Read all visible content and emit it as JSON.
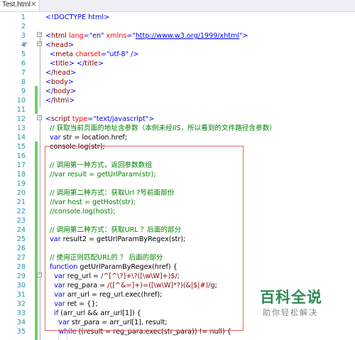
{
  "tab": {
    "label": "Test.html",
    "close": "✕"
  },
  "cursor_glyph": "⇙",
  "watermark": {
    "title": "百科全说",
    "subtitle": "助你轻松解决"
  },
  "lines": [
    {
      "n": "1",
      "seg": [
        [
          "<!DOCTYPE html>",
          "#0000ff"
        ]
      ]
    },
    {
      "n": "2",
      "seg": []
    },
    {
      "n": "3",
      "seg": [
        [
          "<",
          "#0000ff"
        ],
        [
          "html",
          "#800000"
        ],
        [
          " lang",
          "#ff0000"
        ],
        [
          "=",
          "#0000ff"
        ],
        [
          "\"en\"",
          "#0000ff"
        ],
        [
          " xmlns",
          "#ff0000"
        ],
        [
          "=",
          "#0000ff"
        ],
        [
          "\"",
          "#0000ff"
        ],
        [
          "http://www.w3.org/1999/xhtml",
          "#0000ff"
        ],
        [
          "\">",
          "#0000ff"
        ]
      ]
    },
    {
      "n": "4",
      "seg": [
        [
          "<",
          "#0000ff"
        ],
        [
          "head",
          "#800000"
        ],
        [
          ">",
          "#0000ff"
        ]
      ]
    },
    {
      "n": "5",
      "seg": [
        [
          "  <",
          "#0000ff"
        ],
        [
          "meta",
          "#800000"
        ],
        [
          " charset",
          "#ff0000"
        ],
        [
          "=",
          "#0000ff"
        ],
        [
          "\"utf-8\"",
          "#0000ff"
        ],
        [
          " />",
          "#0000ff"
        ]
      ]
    },
    {
      "n": "6",
      "seg": [
        [
          "  <",
          "#0000ff"
        ],
        [
          "title",
          "#800000"
        ],
        [
          "> </",
          "#0000ff"
        ],
        [
          "title",
          "#800000"
        ],
        [
          ">",
          "#0000ff"
        ]
      ]
    },
    {
      "n": "7",
      "seg": [
        [
          "</",
          "#0000ff"
        ],
        [
          "head",
          "#800000"
        ],
        [
          ">",
          "#0000ff"
        ]
      ]
    },
    {
      "n": "8",
      "seg": [
        [
          "<",
          "#0000ff"
        ],
        [
          "body",
          "#800000"
        ],
        [
          ">",
          "#0000ff"
        ]
      ]
    },
    {
      "n": "9",
      "seg": [
        [
          "</",
          "#0000ff"
        ],
        [
          "body",
          "#800000"
        ],
        [
          ">",
          "#0000ff"
        ]
      ]
    },
    {
      "n": "10",
      "seg": [
        [
          "</",
          "#0000ff"
        ],
        [
          "html",
          "#800000"
        ],
        [
          ">",
          "#0000ff"
        ]
      ]
    },
    {
      "n": "11",
      "seg": []
    },
    {
      "n": "12",
      "seg": [
        [
          "<",
          "#0000ff"
        ],
        [
          "script",
          "#800000"
        ],
        [
          " type",
          "#ff0000"
        ],
        [
          "=",
          "#0000ff"
        ],
        [
          "\"text/javascript\"",
          "#0000ff"
        ],
        [
          ">",
          "#0000ff"
        ]
      ]
    },
    {
      "n": "13",
      "seg": [
        [
          "  // 获取当前页面的地址含参数（本例未经IIS，所以看到的文件路径含参数）",
          "#008000"
        ]
      ]
    },
    {
      "n": "14",
      "seg": [
        [
          "  ",
          "#000000"
        ],
        [
          "var",
          "#0000ff"
        ],
        [
          " str = location.href;",
          "#000000"
        ]
      ]
    },
    {
      "n": "15",
      "seg": [
        [
          "  console.log(str);",
          "#000000"
        ]
      ]
    },
    {
      "n": "16",
      "seg": []
    },
    {
      "n": "17",
      "seg": [
        [
          "  // 调用第一种方式，返回参数数组",
          "#008000"
        ]
      ]
    },
    {
      "n": "18",
      "seg": [
        [
          "  //var result = getUrlParam(str);",
          "#008000"
        ]
      ]
    },
    {
      "n": "19",
      "seg": []
    },
    {
      "n": "20",
      "seg": [
        [
          "  // 调用第二种方式：获取Url ?号前面部份",
          "#008000"
        ]
      ]
    },
    {
      "n": "21",
      "seg": [
        [
          "  //var host = getHost(str);",
          "#008000"
        ]
      ]
    },
    {
      "n": "22",
      "seg": [
        [
          "  //console.log(host);",
          "#008000"
        ]
      ]
    },
    {
      "n": "23",
      "seg": []
    },
    {
      "n": "24",
      "seg": [
        [
          "  // 调用第二种方式：获取URL ？后面的部分",
          "#008000"
        ]
      ]
    },
    {
      "n": "25",
      "seg": [
        [
          "  ",
          "#000000"
        ],
        [
          "var",
          "#0000ff"
        ],
        [
          " result2 = getUrlParamByRegex(str);",
          "#000000"
        ]
      ]
    },
    {
      "n": "26",
      "seg": []
    },
    {
      "n": "27",
      "seg": [
        [
          "  // 使用正则匹配URL的 ？ 后面的部分",
          "#008000"
        ]
      ]
    },
    {
      "n": "28",
      "seg": [
        [
          "  ",
          "#000000"
        ],
        [
          "function",
          "#0000ff"
        ],
        [
          " getUrlParamByRegex(href) {",
          "#000000"
        ]
      ]
    },
    {
      "n": "29",
      "seg": [
        [
          "    ",
          "#000000"
        ],
        [
          "var",
          "#0000ff"
        ],
        [
          " reg_url = ",
          "#000000"
        ],
        [
          "/^[^\\?]+\\?([\\w\\W]+)$/",
          "#800000"
        ],
        [
          ";",
          "#000000"
        ]
      ]
    },
    {
      "n": "30",
      "seg": [
        [
          "    ",
          "#000000"
        ],
        [
          "var",
          "#0000ff"
        ],
        [
          " reg_para = ",
          "#000000"
        ],
        [
          "/([^&=]+)=([\\w\\W]*?)(&|$|#)/g",
          "#800000"
        ],
        [
          ";",
          "#000000"
        ]
      ]
    },
    {
      "n": "31",
      "seg": [
        [
          "    ",
          "#000000"
        ],
        [
          "var",
          "#0000ff"
        ],
        [
          " arr_url = reg_url.exec(href);",
          "#000000"
        ]
      ]
    },
    {
      "n": "32",
      "seg": [
        [
          "    ",
          "#000000"
        ],
        [
          "var",
          "#0000ff"
        ],
        [
          " ret = {};",
          "#000000"
        ]
      ]
    },
    {
      "n": "33",
      "seg": [
        [
          "    ",
          "#000000"
        ],
        [
          "if",
          "#0000ff"
        ],
        [
          " (arr_url && arr_url[1]) {",
          "#000000"
        ]
      ]
    },
    {
      "n": "34",
      "seg": [
        [
          "      ",
          "#000000"
        ],
        [
          "var",
          "#0000ff"
        ],
        [
          " str_para = arr_url[1], result;",
          "#000000"
        ]
      ]
    },
    {
      "n": "35",
      "seg": [
        [
          "      ",
          "#000000"
        ],
        [
          "while",
          "#0000ff"
        ],
        [
          " ((result = reg_para.exec(str_para)) != null) {",
          "#000000"
        ]
      ]
    }
  ]
}
